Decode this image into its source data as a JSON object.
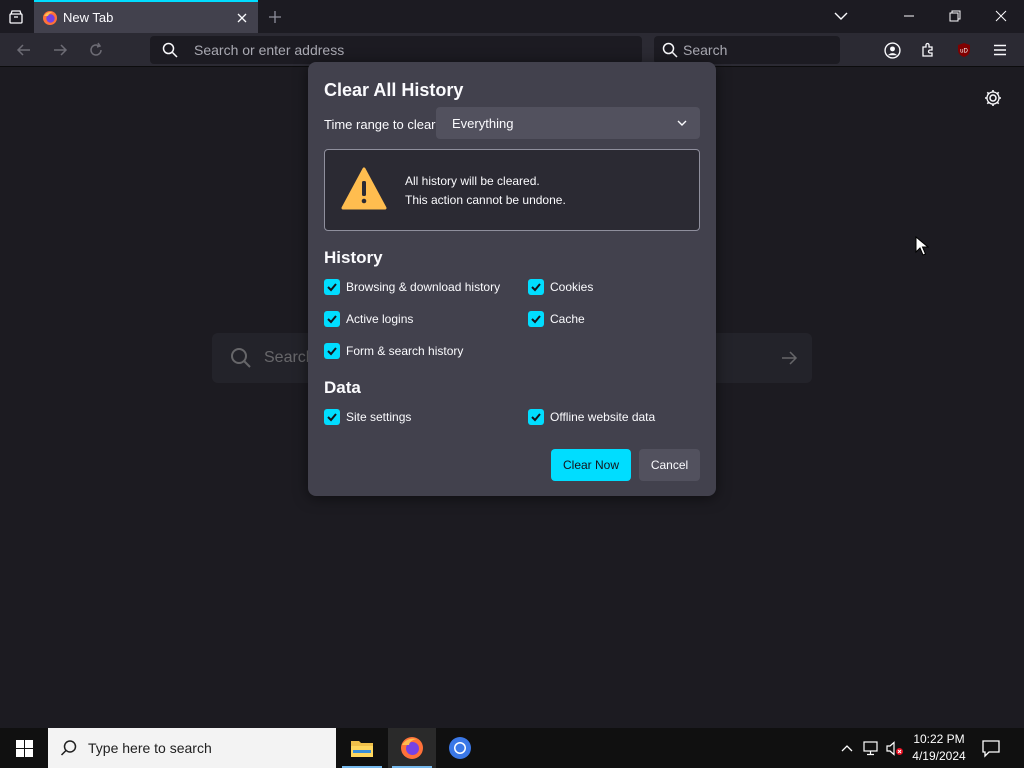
{
  "browser": {
    "tab": {
      "title": "New Tab"
    },
    "urlbar": {
      "placeholder": "Search or enter address"
    },
    "searchbar": {
      "placeholder": "Search"
    },
    "extension_badge": "uD"
  },
  "newtab": {
    "search_placeholder": "Search"
  },
  "dialog": {
    "title": "Clear All History",
    "time_range_label": "Time range to clear:",
    "time_range_value": "Everything",
    "warning": {
      "line1": "All history will be cleared.",
      "line2": "This action cannot be undone."
    },
    "history_heading": "History",
    "history_items": [
      {
        "label": "Browsing & download history",
        "checked": true
      },
      {
        "label": "Cookies",
        "checked": true
      },
      {
        "label": "Active logins",
        "checked": true
      },
      {
        "label": "Cache",
        "checked": true
      },
      {
        "label": "Form & search history",
        "checked": true
      }
    ],
    "data_heading": "Data",
    "data_items": [
      {
        "label": "Site settings",
        "checked": true
      },
      {
        "label": "Offline website data",
        "checked": true
      }
    ],
    "buttons": {
      "clear_now": "Clear Now",
      "cancel": "Cancel"
    }
  },
  "taskbar": {
    "search_placeholder": "Type here to search",
    "time": "10:22 PM",
    "date": "4/19/2024"
  },
  "colors": {
    "accent": "#00ddff",
    "dialog_bg": "#42414d",
    "content_bg": "#2b2a33",
    "warning_yellow": "#ffbd4f"
  }
}
